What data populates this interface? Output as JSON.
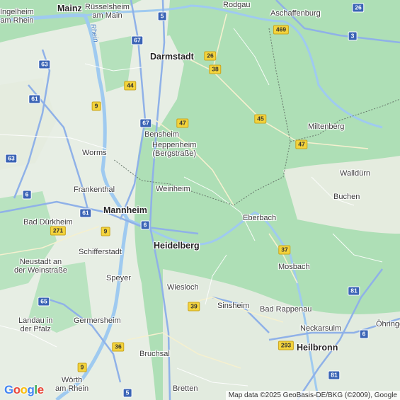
{
  "map": {
    "cities": [
      {
        "id": "mainz",
        "name": "Mainz",
        "major": true
      },
      {
        "id": "ruesselsheim",
        "name": "Rüsselsheim\nam Main"
      },
      {
        "id": "rodgau",
        "name": "Rodgau"
      },
      {
        "id": "aschaffenburg",
        "name": "Aschaffenburg"
      },
      {
        "id": "ingelheim",
        "name": "Ingelheim\nam Rhein"
      },
      {
        "id": "darmstadt",
        "name": "Darmstadt",
        "major": true
      },
      {
        "id": "miltenberg",
        "name": "Miltenberg"
      },
      {
        "id": "bensheim",
        "name": "Bensheim"
      },
      {
        "id": "heppenheim",
        "name": "Heppenheim\n(Bergstraße)"
      },
      {
        "id": "worms",
        "name": "Worms"
      },
      {
        "id": "walldurn",
        "name": "Walldürn"
      },
      {
        "id": "frankenthal",
        "name": "Frankenthal"
      },
      {
        "id": "weinheim",
        "name": "Weinheim"
      },
      {
        "id": "buchen",
        "name": "Buchen"
      },
      {
        "id": "mannheim",
        "name": "Mannheim",
        "major": true
      },
      {
        "id": "eberbach",
        "name": "Eberbach"
      },
      {
        "id": "baddurkheim",
        "name": "Bad Dürkheim"
      },
      {
        "id": "heidelberg",
        "name": "Heidelberg",
        "major": true
      },
      {
        "id": "schifferstadt",
        "name": "Schifferstadt"
      },
      {
        "id": "mosbach",
        "name": "Mosbach"
      },
      {
        "id": "neustadt",
        "name": "Neustadt an\nder Weinstraße"
      },
      {
        "id": "speyer",
        "name": "Speyer"
      },
      {
        "id": "wiesloch",
        "name": "Wiesloch"
      },
      {
        "id": "sinsheim",
        "name": "Sinsheim"
      },
      {
        "id": "badrappenau",
        "name": "Bad Rappenau"
      },
      {
        "id": "landau",
        "name": "Landau in\nder Pfalz"
      },
      {
        "id": "germersheim",
        "name": "Germersheim"
      },
      {
        "id": "neckarsulm",
        "name": "Neckarsulm"
      },
      {
        "id": "ohringen",
        "name": "Öhringe"
      },
      {
        "id": "heilbronn",
        "name": "Heilbronn",
        "major": true
      },
      {
        "id": "bruchsal",
        "name": "Bruchsal"
      },
      {
        "id": "worth",
        "name": "Wörth\nam Rhein"
      },
      {
        "id": "bretten",
        "name": "Bretten"
      }
    ],
    "shields": [
      {
        "id": "a5-top",
        "label": "5",
        "color": "blue"
      },
      {
        "id": "b26-top",
        "label": "26",
        "color": "blue"
      },
      {
        "id": "a67-n",
        "label": "67",
        "color": "blue"
      },
      {
        "id": "b469",
        "label": "469",
        "color": "yellow"
      },
      {
        "id": "a3",
        "label": "3",
        "color": "blue"
      },
      {
        "id": "a63-n",
        "label": "63",
        "color": "blue"
      },
      {
        "id": "b26-dar",
        "label": "26",
        "color": "yellow"
      },
      {
        "id": "b38",
        "label": "38",
        "color": "yellow"
      },
      {
        "id": "b44",
        "label": "44",
        "color": "yellow"
      },
      {
        "id": "a61-n",
        "label": "61",
        "color": "blue"
      },
      {
        "id": "b9-n",
        "label": "9",
        "color": "yellow"
      },
      {
        "id": "a67-s",
        "label": "67",
        "color": "blue"
      },
      {
        "id": "b47-w",
        "label": "47",
        "color": "yellow"
      },
      {
        "id": "b45",
        "label": "45",
        "color": "yellow"
      },
      {
        "id": "b47-e",
        "label": "47",
        "color": "yellow"
      },
      {
        "id": "a63-s",
        "label": "63",
        "color": "blue"
      },
      {
        "id": "a6-w",
        "label": "6",
        "color": "blue"
      },
      {
        "id": "a61-s",
        "label": "61",
        "color": "blue"
      },
      {
        "id": "b271",
        "label": "271",
        "color": "yellow"
      },
      {
        "id": "b9-m",
        "label": "9",
        "color": "yellow"
      },
      {
        "id": "a6-m",
        "label": "6",
        "color": "blue"
      },
      {
        "id": "b37",
        "label": "37",
        "color": "yellow"
      },
      {
        "id": "a65",
        "label": "65",
        "color": "blue"
      },
      {
        "id": "b39",
        "label": "39",
        "color": "yellow"
      },
      {
        "id": "a81-n",
        "label": "81",
        "color": "blue"
      },
      {
        "id": "a6-e",
        "label": "6",
        "color": "blue"
      },
      {
        "id": "b36",
        "label": "36",
        "color": "yellow"
      },
      {
        "id": "b293",
        "label": "293",
        "color": "yellow"
      },
      {
        "id": "b9-s",
        "label": "9",
        "color": "yellow"
      },
      {
        "id": "a81-s",
        "label": "81",
        "color": "blue"
      },
      {
        "id": "a5-bot",
        "label": "5",
        "color": "blue"
      }
    ],
    "river_label": "Rhein",
    "logo": "Google",
    "logo_colors": [
      "#4285F4",
      "#EA4335",
      "#FBBC05",
      "#4285F4",
      "#34A853",
      "#EA4335"
    ],
    "attribution": "Map data ©2025 GeoBasis-DE/BKG (©2009), Google",
    "colors": {
      "forest": "#aedfb6",
      "open_land": "#e9efe6",
      "water": "#9fcaf0",
      "highway": "#8aaee6",
      "road": "#ffffff",
      "border": "#6f7f73"
    }
  }
}
